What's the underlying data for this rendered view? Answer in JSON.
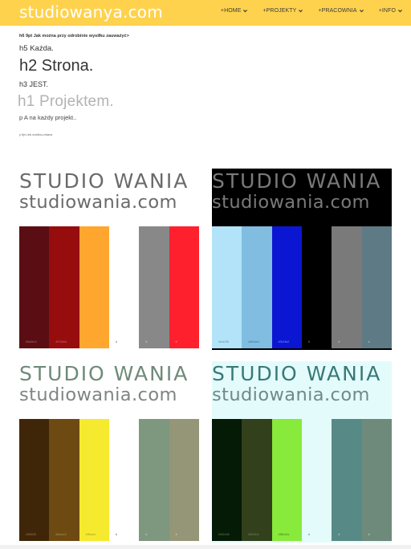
{
  "header": {
    "logo": "studiowanya.com",
    "nav": [
      {
        "label": "+HOME"
      },
      {
        "label": "+PROJEKTY"
      },
      {
        "label": "+PRACOWNIA"
      },
      {
        "label": "+INFO"
      }
    ]
  },
  "content": {
    "h6": "h6 9pt Jak można przy odrobinie wysiłku zauważyć>",
    "h5": "h5 Każda.",
    "h2": "h2 Strona.",
    "h3": "h3 JEST.",
    "h1": "h1 Projektem.",
    "p1": "p A na każdy projekt..",
    "p2": "p 8pt Link możliwo-zmiana"
  },
  "cards": [
    {
      "title": "STUDIO WANIA",
      "url": "studiowania.com",
      "bg": "#ffffff",
      "title_color": "#6a6a6a",
      "url_color": "#6a6a6a",
      "swatches": [
        {
          "color": "#5a0e14",
          "hex": "#5a0e14",
          "hex_color": "#b07070"
        },
        {
          "color": "#970d0d",
          "hex": "#970d0d",
          "hex_color": "#c97070"
        },
        {
          "color": "#ffa62e",
          "hex": "",
          "hex_color": "#ffffff"
        },
        {
          "color": "#ffffff",
          "hex": "#",
          "hex_color": "#555555"
        },
        {
          "color": "#888888",
          "hex": "#",
          "hex_color": "#dddddd"
        },
        {
          "color": "#ff202e",
          "hex": "#",
          "hex_color": "#ffb0b0"
        }
      ]
    },
    {
      "title": "STUDIO WANIA",
      "url": "studiowania.com",
      "bg": "#000000",
      "title_color": "#7a7a7a",
      "url_color": "#7a7a7a",
      "swatches": [
        {
          "color": "#b3e3f8",
          "hex": "#b3e3f8",
          "hex_color": "#6a8fa0"
        },
        {
          "color": "#80bde0",
          "hex": "#80bde0",
          "hex_color": "#4a7590"
        },
        {
          "color": "#0b16d2",
          "hex": "#0b16d2",
          "hex_color": "#8890ff"
        },
        {
          "color": "#000000",
          "hex": "#",
          "hex_color": "#9a9a9a"
        },
        {
          "color": "#7a7a7a",
          "hex": "#",
          "hex_color": "#d0d0d0"
        },
        {
          "color": "#5e7a85",
          "hex": "#",
          "hex_color": "#c0d0d8"
        }
      ]
    },
    {
      "title": "STUDIO WANIA",
      "url": "studiowania.com",
      "bg": "#ffffff",
      "title_color": "#6f8a78",
      "url_color": "#7f8580",
      "swatches": [
        {
          "color": "#3f2608",
          "hex": "#3f2608",
          "hex_color": "#9a7a50"
        },
        {
          "color": "#6d4a12",
          "hex": "#6d4a12",
          "hex_color": "#b09060"
        },
        {
          "color": "#f5ea2e",
          "hex": "#f5ea2e",
          "hex_color": "#a09a30"
        },
        {
          "color": "#ffffff",
          "hex": "#",
          "hex_color": "#555555"
        },
        {
          "color": "#7e977f",
          "hex": "#",
          "hex_color": "#cfe0cf"
        },
        {
          "color": "#959677",
          "hex": "#",
          "hex_color": "#dedec8"
        }
      ]
    },
    {
      "title": "STUDIO WANIA",
      "url": "studiowania.com",
      "bg": "#e3fcfb",
      "title_color": "#3a7878",
      "url_color": "#6f8a88",
      "swatches": [
        {
          "color": "#061b06",
          "hex": "#061b06",
          "hex_color": "#5a8060"
        },
        {
          "color": "#32401c",
          "hex": "#32401c",
          "hex_color": "#7a9060"
        },
        {
          "color": "#88ea3a",
          "hex": "#88ea3a",
          "hex_color": "#4a8020"
        },
        {
          "color": "#e3fcfb",
          "hex": "#",
          "hex_color": "#555555"
        },
        {
          "color": "#578a86",
          "hex": "#",
          "hex_color": "#c8e0dd"
        },
        {
          "color": "#6e8a7b",
          "hex": "#",
          "hex_color": "#d0e0d8"
        }
      ]
    }
  ]
}
